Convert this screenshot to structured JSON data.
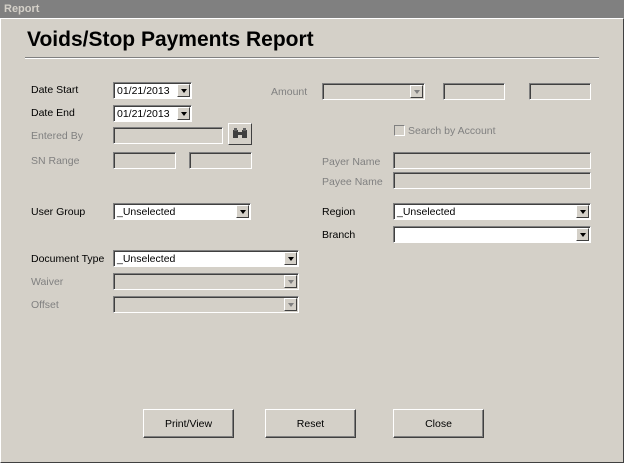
{
  "window": {
    "title": "Report"
  },
  "page": {
    "title": "Voids/Stop Payments Report"
  },
  "labels": {
    "date_start": "Date Start",
    "date_end": "Date End",
    "entered_by": "Entered By",
    "sn_range": "SN Range",
    "user_group": "User Group",
    "document_type": "Document Type",
    "waiver": "Waiver",
    "offset": "Offset",
    "amount": "Amount",
    "search_by_account": "Search by Account",
    "payer_name": "Payer Name",
    "payee_name": "Payee Name",
    "region": "Region",
    "branch": "Branch"
  },
  "values": {
    "date_start": "01/21/2013",
    "date_end": "01/21/2013",
    "user_group": "_Unselected",
    "document_type": "_Unselected",
    "region": "_Unselected",
    "branch": ""
  },
  "buttons": {
    "print_view": "Print/View",
    "reset": "Reset",
    "close": "Close"
  },
  "icons": {
    "search_user": "binoculars-icon"
  }
}
